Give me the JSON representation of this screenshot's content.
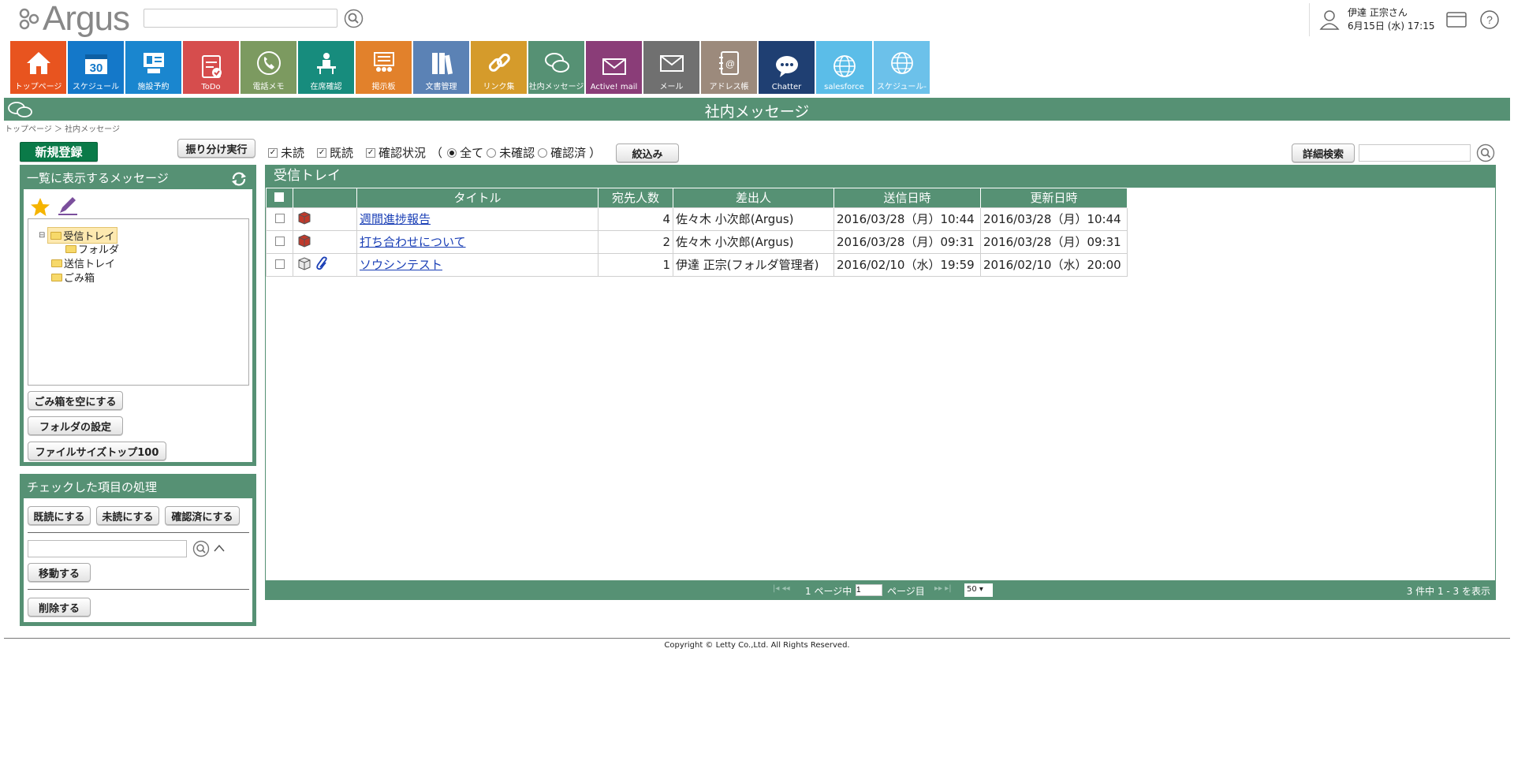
{
  "header": {
    "logo_text": "Argus",
    "search_value": "",
    "user_name": "伊達 正宗さん",
    "datetime": "6月15日 (水) 17:15"
  },
  "tiles": [
    {
      "label": "トップページ",
      "color": "#e8541f",
      "icon": "home-icon"
    },
    {
      "label": "スケジュール",
      "color": "#1478c9",
      "icon": "calendar-icon",
      "day": "30"
    },
    {
      "label": "施設予約",
      "color": "#1a86cf",
      "icon": "facility-icon"
    },
    {
      "label": "ToDo",
      "color": "#d64d4d",
      "icon": "todo-icon"
    },
    {
      "label": "電話メモ",
      "color": "#7c9a60",
      "icon": "phone-icon"
    },
    {
      "label": "在席確認",
      "color": "#178c7d",
      "icon": "presence-icon"
    },
    {
      "label": "掲示板",
      "color": "#e2812b",
      "icon": "board-icon"
    },
    {
      "label": "文書管理",
      "color": "#5b82b5",
      "icon": "document-icon"
    },
    {
      "label": "リンク集",
      "color": "#d59b2b",
      "icon": "link-icon"
    },
    {
      "label": "社内メッセージ",
      "color": "#569174",
      "icon": "message-icon"
    },
    {
      "label": "Active! mail",
      "color": "#8a3d78",
      "icon": "mail-icon"
    },
    {
      "label": "メール",
      "color": "#707070",
      "icon": "mail-icon"
    },
    {
      "label": "アドレス帳",
      "color": "#9c8a7c",
      "icon": "address-book-icon"
    },
    {
      "label": "Chatter",
      "color": "#1f3f72",
      "icon": "chatter-icon"
    },
    {
      "label": "salesforce",
      "color": "#5bbde8",
      "icon": "globe-icon"
    },
    {
      "label": "スケジュール-",
      "color": "#6cc1ea",
      "icon": "globe-icon"
    }
  ],
  "page_title": "社内メッセージ",
  "breadcrumb": "トップページ ＞ 社内メッセージ",
  "buttons": {
    "new": "新規登録",
    "sort_run": "振り分け実行",
    "empty_trash": "ごみ箱を空にする",
    "folder_settings": "フォルダの設定",
    "file_size_top": "ファイルサイズトップ100",
    "mark_read": "既読にする",
    "mark_unread": "未読にする",
    "mark_confirmed": "確認済にする",
    "move": "移動する",
    "delete": "削除する",
    "filter": "絞込み",
    "advanced_search": "詳細検索"
  },
  "left_panel": {
    "title": "一覧に表示するメッセージ",
    "tree": [
      {
        "label": "受信トレイ",
        "level": 0,
        "selected": true,
        "expander": "⊟"
      },
      {
        "label": "フォルダ",
        "level": 1
      },
      {
        "label": "送信トレイ",
        "level": 0
      },
      {
        "label": "ごみ箱",
        "level": 0
      }
    ]
  },
  "action_panel": {
    "title": "チェックした項目の処理",
    "move_target_value": ""
  },
  "filters": {
    "unread": "未読",
    "read": "既読",
    "confirm_status": "確認状況",
    "paren_open": "（",
    "paren_close": "）",
    "radio_all": "全て",
    "radio_unconfirmed": "未確認",
    "radio_confirmed": "確認済",
    "unread_checked": true,
    "read_checked": true,
    "confirm_checked": true,
    "selected_radio": "全て"
  },
  "inbox": {
    "title": "受信トレイ",
    "columns": [
      "タイトル",
      "宛先人数",
      "差出人",
      "送信日時",
      "更新日時"
    ],
    "rows": [
      {
        "title": "週間進捗報告",
        "recipients": "4",
        "sender": "佐々木 小次郎(Argus)",
        "sent": "2016/03/28（月）10:44",
        "updated": "2016/03/28（月）10:44",
        "icon": "unread-box-icon",
        "attachment": false
      },
      {
        "title": "打ち合わせについて",
        "recipients": "2",
        "sender": "佐々木 小次郎(Argus)",
        "sent": "2016/03/28（月）09:31",
        "updated": "2016/03/28（月）09:31",
        "icon": "unread-box-icon",
        "attachment": false
      },
      {
        "title": "ソウシンテスト",
        "recipients": "1",
        "sender": "伊達 正宗(フォルダ管理者)",
        "sent": "2016/02/10（水）19:59",
        "updated": "2016/02/10（水）20:00",
        "icon": "read-box-icon",
        "attachment": true
      }
    ]
  },
  "pager": {
    "page_prefix": "1 ページ中",
    "page_value": "1",
    "page_suffix": "ページ目",
    "per_page": "50",
    "summary": "3 件中 1 - 3 を表示"
  },
  "footer": {
    "copyright": "Copyright © Letty Co.,Ltd. All Rights Reserved."
  }
}
